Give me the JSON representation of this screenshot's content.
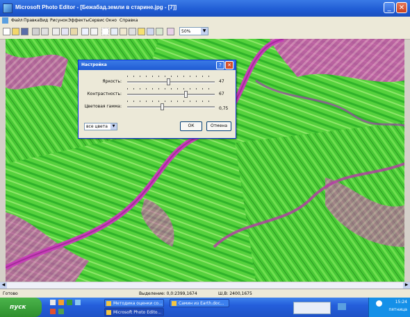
{
  "window": {
    "title": "Microsoft Photo Editor - [Бежабад.земли в старине.jpg - [7]]",
    "controls": [
      "minimize-icon",
      "close-icon"
    ]
  },
  "menu": [
    "Файл",
    "Правка",
    "Вид",
    "Рисунок",
    "Эффекты",
    "Сервис",
    "Окно",
    "Справка"
  ],
  "toolbar": {
    "zoom_value": "50%"
  },
  "dialog": {
    "title": "Настройка",
    "sliders": [
      {
        "label": "Яркость:",
        "value": "47",
        "position": 0.47
      },
      {
        "label": "Контрастность:",
        "value": "67",
        "position": 0.67
      },
      {
        "label": "Цветовая гамма:",
        "value": "0,75",
        "position": 0.4
      }
    ],
    "channel_select": "все цвета",
    "ok_label": "ОК",
    "cancel_label": "Отмена"
  },
  "status": {
    "ready": "Готово",
    "selection": "Выделение: 0,0:2399,1674",
    "size": "Ш,В: 2400,1675"
  },
  "taskbar": {
    "start_label": "пуск",
    "tasks": [
      "Методика оценки со...",
      "Самин из Earth.doc...",
      "Microsoft Photo Edito..."
    ],
    "clock": "15:24",
    "day": "пятница"
  },
  "colors": {
    "accent": "#1f5bd3",
    "image_green": "#4fd33a",
    "image_magenta": "#d8459a"
  }
}
